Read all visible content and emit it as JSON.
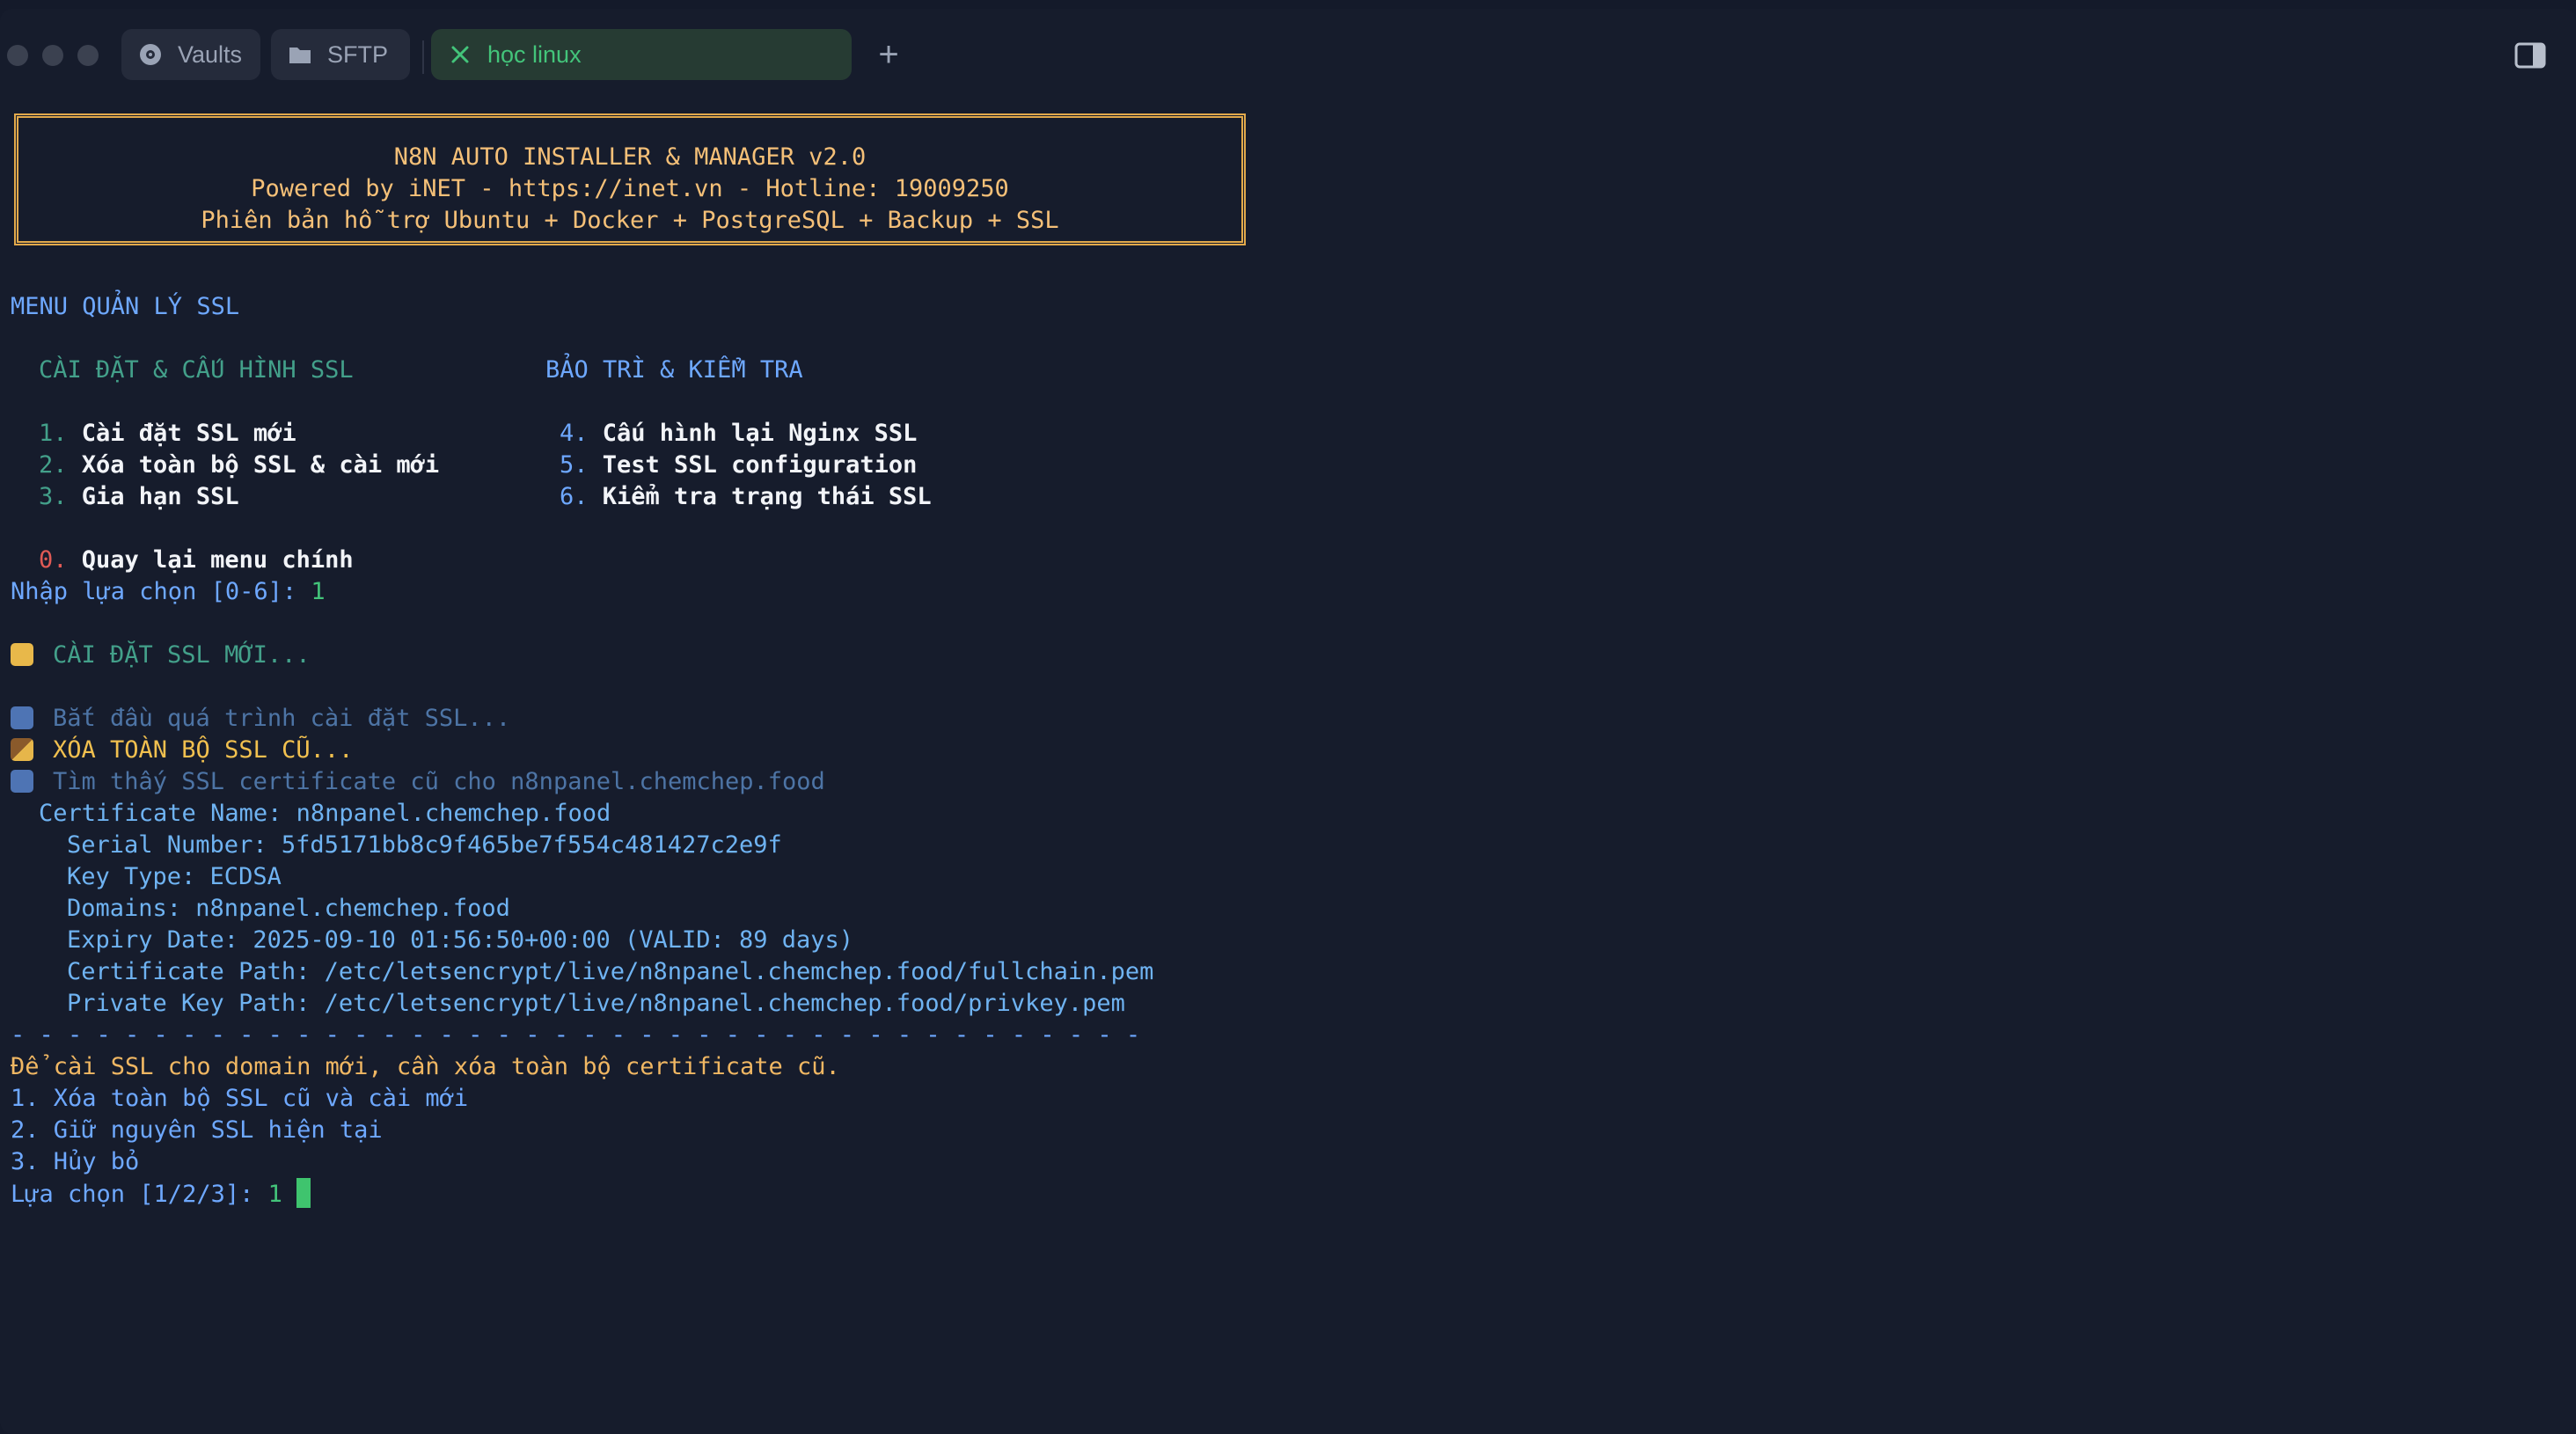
{
  "tabs": [
    {
      "label": "Vaults",
      "icon": "vault-icon"
    },
    {
      "label": "SFTP",
      "icon": "folder-icon"
    },
    {
      "label": "học linux",
      "icon": "close-icon",
      "active": true
    }
  ],
  "banner": {
    "line1": "N8N AUTO INSTALLER & MANAGER v2.0",
    "line2": "Powered by iNET - https://inet.vn -  Hotline: 19009250",
    "line3": "Phiên bản hỗ trợ Ubuntu + Docker + PostgreSQL + Backup + SSL"
  },
  "menu": {
    "title": "MENU QUẢN LÝ SSL",
    "col1_heading": "CÀI ĐẶT & CẤU HÌNH SSL",
    "col2_heading": "BẢO TRÌ & KIỂM TRA",
    "items": [
      {
        "num": "1.",
        "label": "Cài đặt SSL mới"
      },
      {
        "num": "2.",
        "label": "Xóa toàn bộ SSL & cài mới"
      },
      {
        "num": "3.",
        "label": "Gia hạn SSL"
      },
      {
        "num": "4.",
        "label": "Cấu hình lại Nginx SSL"
      },
      {
        "num": "5.",
        "label": "Test SSL configuration"
      },
      {
        "num": "6.",
        "label": "Kiểm tra trạng thái SSL"
      }
    ],
    "back_num": "0.",
    "back_label": "Quay lại menu chính",
    "prompt": "Nhập lựa chọn [0-6]: ",
    "prompt_value": "1"
  },
  "output": {
    "installing": "CÀI ĐẶT SSL MỚI...",
    "start": "Bắt đầu quá trình cài đặt SSL...",
    "delete_all": "XÓA TOÀN BỘ SSL CŨ...",
    "found": "Tìm thấy SSL certificate cũ cho n8npanel.chemchep.food",
    "cert_name": "Certificate Name: n8npanel.chemchep.food",
    "serial": "Serial Number: 5fd5171bb8c9f465be7f554c481427c2e9f",
    "key_type": "Key Type: ECDSA",
    "domains": "Domains: n8npanel.chemchep.food",
    "expiry": "Expiry Date: 2025-09-10 01:56:50+00:00 (VALID: 89 days)",
    "cert_path": "Certificate Path: /etc/letsencrypt/live/n8npanel.chemchep.food/fullchain.pem",
    "key_path": "Private Key Path: /etc/letsencrypt/live/n8npanel.chemchep.food/privkey.pem",
    "separator": "- - - - - - - - - - - - - - - - - - - - - - - - - - - - - - - - - - - - - - - -",
    "notice": "Để cài SSL cho domain mới, cần xóa toàn bộ certificate cũ.",
    "opt1": "1. Xóa toàn bộ SSL cũ và cài mới",
    "opt2": "2. Giữ nguyên SSL hiện tại",
    "opt3": "3. Hủy bỏ",
    "choice_prompt": "Lựa chọn [1/2/3]: ",
    "choice_value": "1"
  }
}
